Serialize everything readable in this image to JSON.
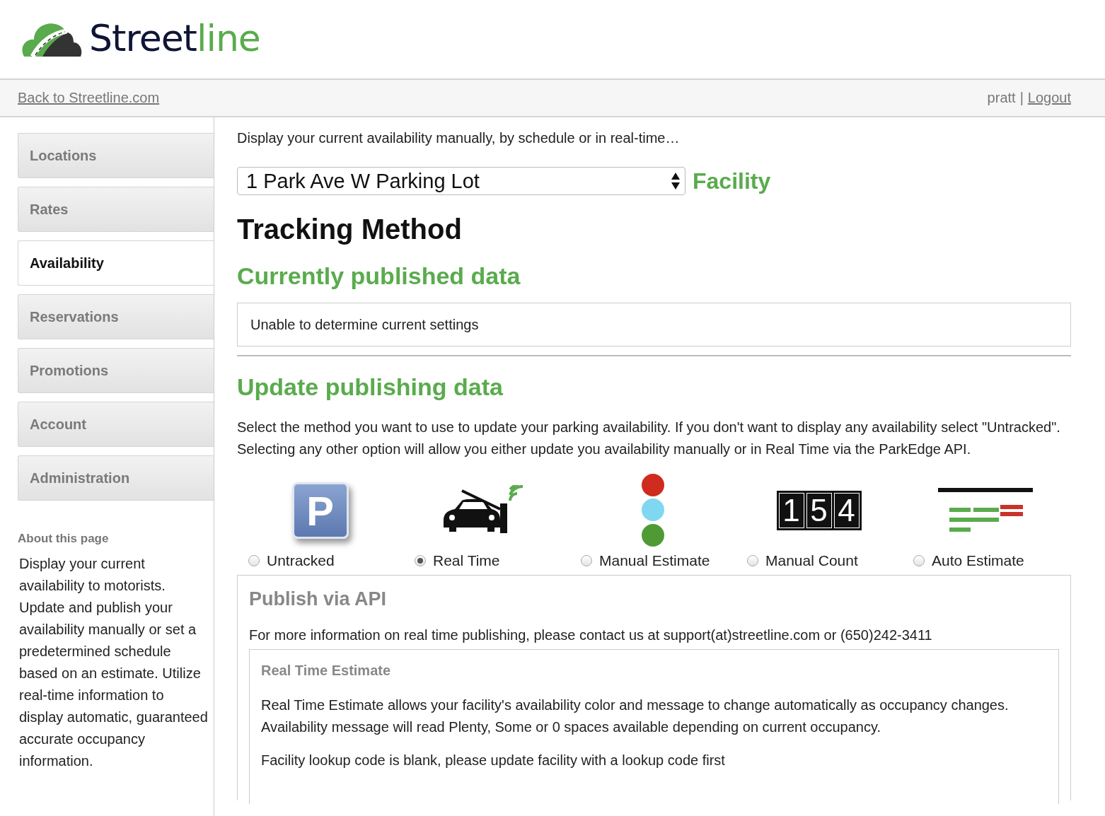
{
  "logo": {
    "word_main": "Street",
    "word_accent": "line"
  },
  "topbar": {
    "back_link": "Back to Streetline.com",
    "user": "pratt",
    "separator": "|",
    "logout_link": "Logout"
  },
  "sidebar": {
    "items": [
      {
        "label": "Locations",
        "selected": false
      },
      {
        "label": "Rates",
        "selected": false
      },
      {
        "label": "Availability",
        "selected": true
      },
      {
        "label": "Reservations",
        "selected": false
      },
      {
        "label": "Promotions",
        "selected": false
      },
      {
        "label": "Account",
        "selected": false
      },
      {
        "label": "Administration",
        "selected": false
      }
    ],
    "about_title": "About this page",
    "about_text": "Display your current availability to motorists. Update and publish your availability manually or set a predetermined schedule based on an estimate. Utilize real-time information to display automatic, guaranteed accurate occupancy information."
  },
  "main": {
    "intro": "Display your current availability manually, by schedule or in real-time…",
    "facility_select": {
      "value": "1 Park Ave W Parking Lot"
    },
    "facility_label": "Facility",
    "title": "Tracking Method",
    "current_heading": "Currently published data",
    "current_settings": "Unable to determine current settings",
    "update_heading": "Update publishing data",
    "update_text": "Select the method you want to use to update your parking availability. If you don't want to display any availability select \"Untracked\". Selecting any other option will allow you either update you availability manually or in Real Time via the ParkEdge API.",
    "methods": [
      {
        "kind": "untracked",
        "label": "Untracked",
        "selected": false,
        "icon_text": "P"
      },
      {
        "kind": "realtime",
        "label": "Real Time",
        "selected": true
      },
      {
        "kind": "manual_estimate",
        "label": "Manual Estimate",
        "selected": false
      },
      {
        "kind": "manual_count",
        "label": "Manual Count",
        "selected": false,
        "digits": [
          "1",
          "5",
          "4"
        ]
      },
      {
        "kind": "auto_estimate",
        "label": "Auto Estimate",
        "selected": false
      }
    ],
    "api_panel": {
      "title": "Publish via API",
      "info": "For more information on real time publishing, please contact us at support(at)streetline.com or (650)242-3411",
      "estimate": {
        "title": "Real Time Estimate",
        "text": "Real Time Estimate allows your facility's availability color and message to change automatically as occupancy changes. Availability message will read Plenty, Some or 0 spaces available depending on current occupancy.",
        "note": "Facility lookup code is blank, please update facility with a lookup code first"
      }
    }
  }
}
